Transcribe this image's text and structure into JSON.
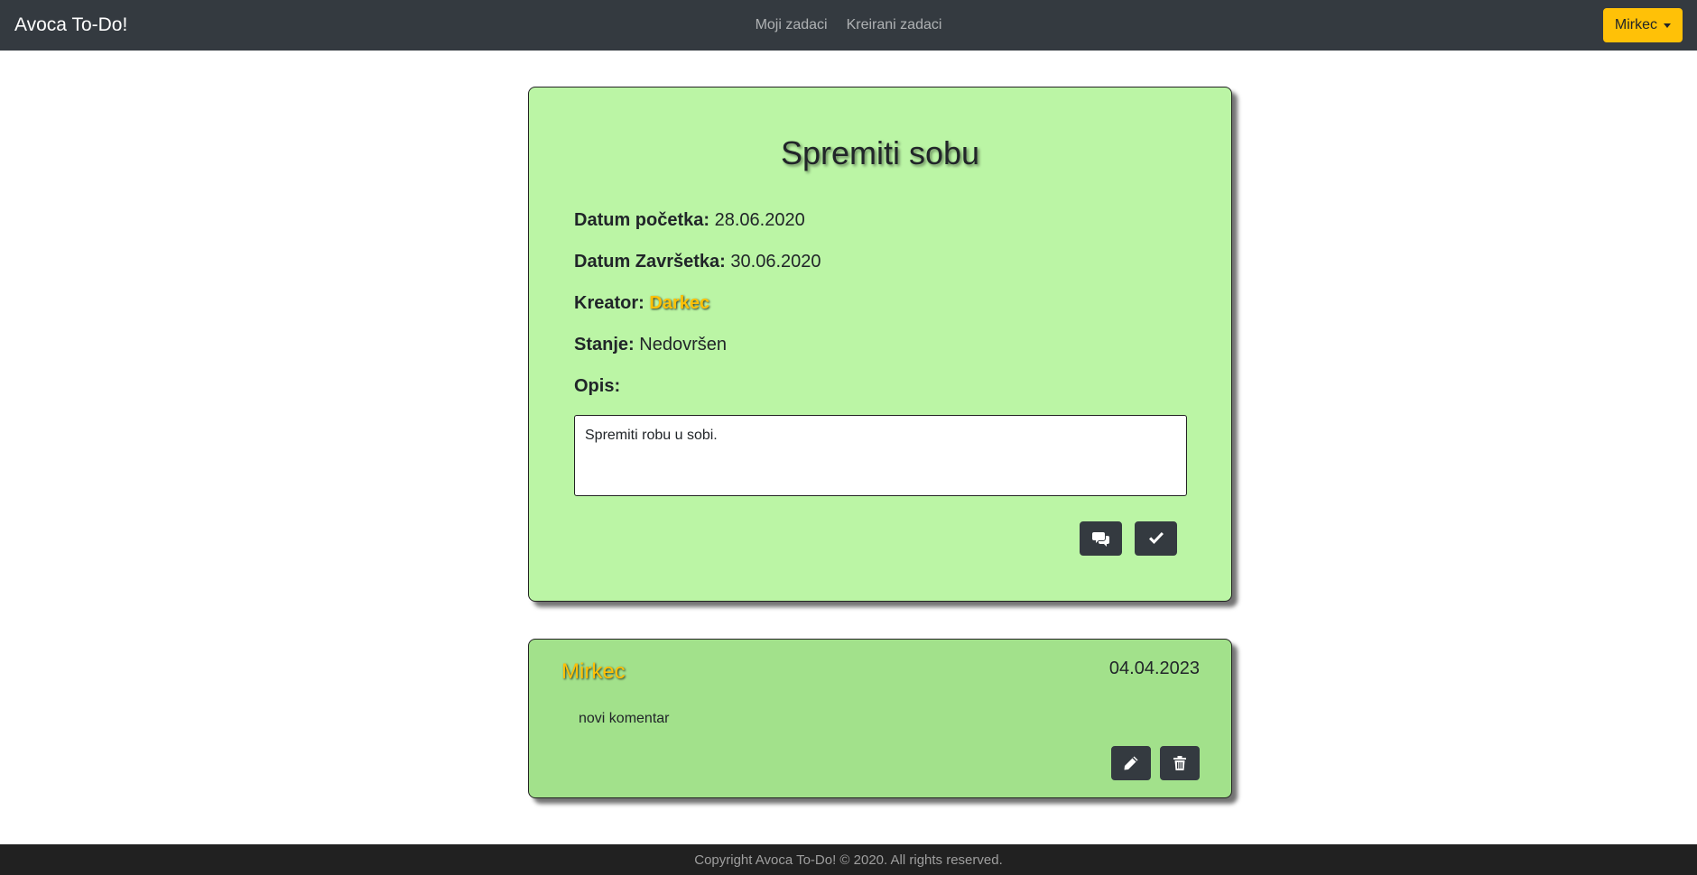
{
  "navbar": {
    "brand": "Avoca To-Do!",
    "links": [
      {
        "label": "Moji zadaci"
      },
      {
        "label": "Kreirani zadaci"
      }
    ],
    "user_menu_label": "Mirkec",
    "background_color": "#343a40",
    "user_button_color": "#ffc107"
  },
  "task": {
    "title": "Spremiti sobu",
    "start_date_label": "Datum početka:",
    "start_date": "28.06.2020",
    "end_date_label": "Datum Završetka:",
    "end_date": "30.06.2020",
    "creator_label": "Kreator:",
    "creator": "Darkec",
    "status_label": "Stanje:",
    "status": "Nedovršen",
    "description_label": "Opis:",
    "description": "Spremiti robu u sobi.",
    "actions": [
      {
        "icon": "comments-icon"
      },
      {
        "icon": "check-icon"
      }
    ],
    "background_color": "#bbf5a5"
  },
  "comments": [
    {
      "author": "Mirkec",
      "date": "04.04.2023",
      "text": "novi komentar",
      "actions": [
        {
          "icon": "pencil-icon"
        },
        {
          "icon": "trash-icon"
        }
      ],
      "background_color": "#a2e18b"
    }
  ],
  "footer": {
    "text": "Copyright Avoca To-Do! © 2020. All rights reserved."
  }
}
